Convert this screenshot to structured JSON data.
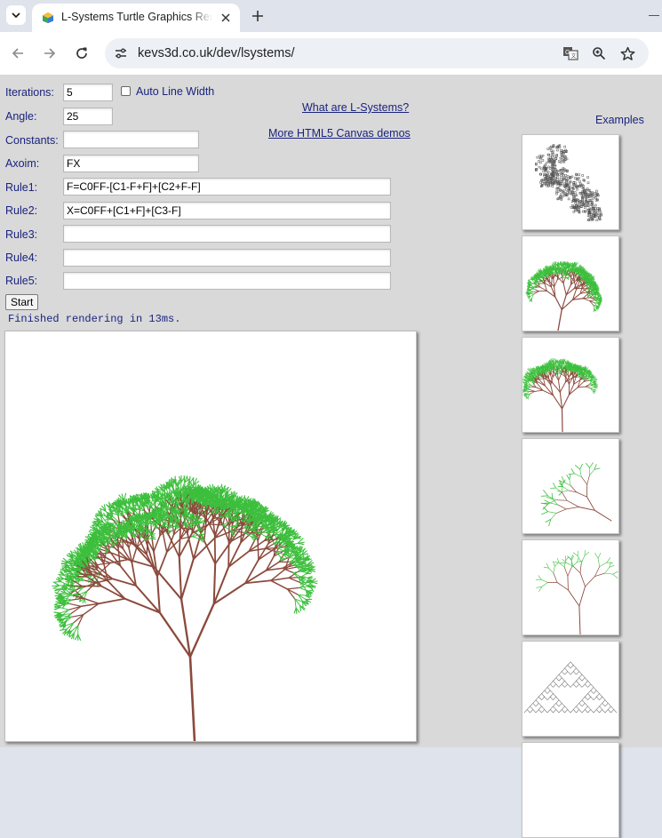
{
  "browser": {
    "tab_title": "L-Systems Turtle Graphics Renderer",
    "url": "kevs3d.co.uk/dev/lsystems/"
  },
  "form": {
    "iterations_label": "Iterations:",
    "iterations_value": "5",
    "auto_line_width_label": "Auto Line Width",
    "angle_label": "Angle:",
    "angle_value": "25",
    "constants_label": "Constants:",
    "constants_value": "",
    "axiom_label": "Axoim:",
    "axiom_value": "FX",
    "rule1_label": "Rule1:",
    "rule1_value": "F=C0FF-[C1-F+F]+[C2+F-F]",
    "rule2_label": "Rule2:",
    "rule2_value": "X=C0FF+[C1+F]+[C3-F]",
    "rule3_label": "Rule3:",
    "rule3_value": "",
    "rule4_label": "Rule4:",
    "rule4_value": "",
    "rule5_label": "Rule5:",
    "rule5_value": "",
    "start_label": "Start"
  },
  "links": {
    "what_are": "What are L-Systems?",
    "more_demos": "More HTML5 Canvas demos"
  },
  "status": "Finished rendering in 13ms.",
  "examples": {
    "label": "Examples",
    "thumbnails": [
      "dragon-curve-grey",
      "green-bush",
      "green-tree",
      "green-weed-diagonal",
      "sparse-green-plant",
      "sierpinski-grey"
    ]
  },
  "colors": {
    "label_text": "#1a237e",
    "branch": "#8b4a3c",
    "leaf": "#3dbf3d",
    "page_bg": "#d9d9d9"
  }
}
